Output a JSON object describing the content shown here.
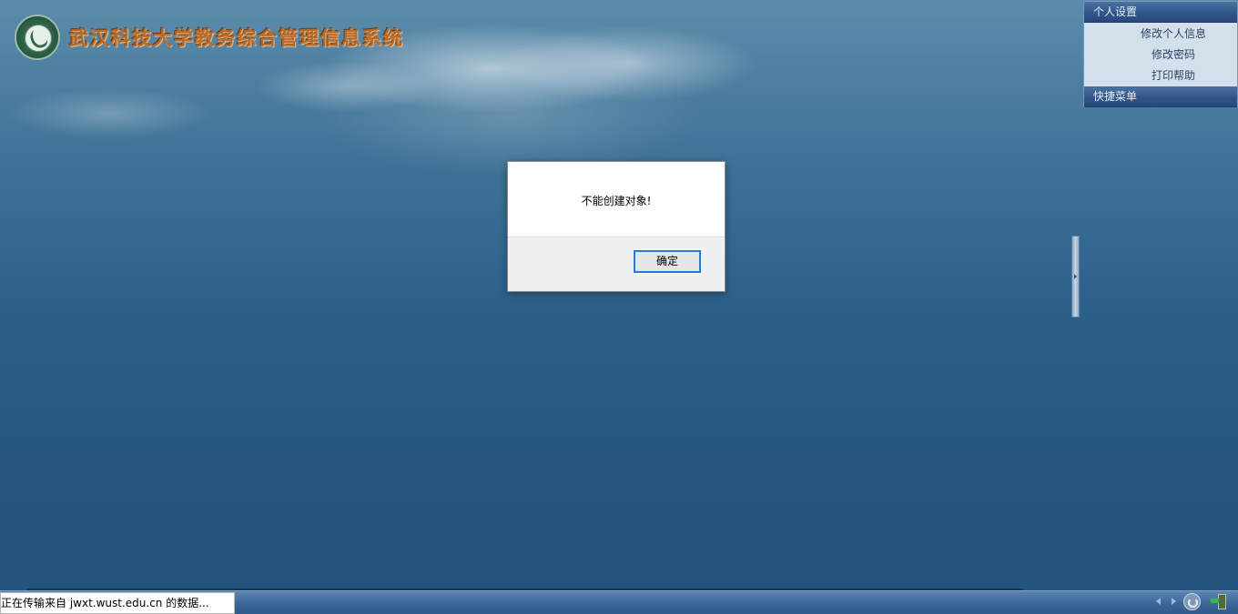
{
  "header": {
    "title": "武汉科技大学教务综合管理信息系统",
    "logo_icon": "university-seal-icon"
  },
  "right_panel": {
    "personal_settings": {
      "title": "个人设置",
      "items": [
        {
          "label": "修改个人信息"
        },
        {
          "label": "修改密码"
        },
        {
          "label": "打印帮助"
        }
      ]
    },
    "quick_menu": {
      "title": "快捷菜单"
    }
  },
  "dialog": {
    "message": "不能创建对象!",
    "ok_label": "确定"
  },
  "status_bar": {
    "text": "正在传输来自 jwxt.wust.edu.cn 的数据..."
  },
  "colors": {
    "title_text": "#b86a2a",
    "dialog_button_border": "#2b7bd4",
    "panel_header": "#2f5487"
  }
}
